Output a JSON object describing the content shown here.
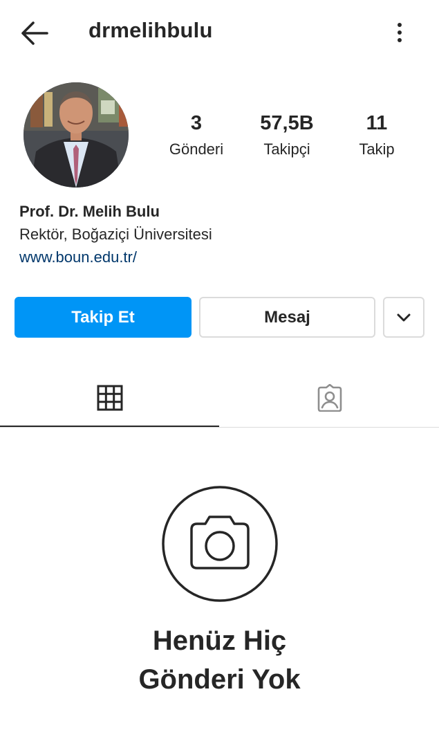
{
  "header": {
    "username": "drmelihbulu",
    "back_icon": "arrow-left-icon",
    "more_icon": "vertical-dots-icon"
  },
  "profile": {
    "avatar": "profile-photo",
    "stats": {
      "posts_count": "3",
      "posts_label": "Gönderi",
      "followers_count": "57,5B",
      "followers_label": "Takipçi",
      "following_count": "11",
      "following_label": "Takip"
    },
    "bio": {
      "name": "Prof. Dr. Melih Bulu",
      "description": "Rektör, Boğaziçi Üniversitesi",
      "link": "www.boun.edu.tr/"
    }
  },
  "actions": {
    "follow_label": "Takip Et",
    "message_label": "Mesaj",
    "more_icon": "chevron-down-icon"
  },
  "tabs": {
    "grid_icon": "grid-icon",
    "tagged_icon": "tagged-person-icon",
    "active": "grid"
  },
  "empty_state": {
    "icon": "camera-icon",
    "title": "Henüz Hiç\nGönderi Yok"
  },
  "colors": {
    "accent": "#0095f6",
    "text": "#262626",
    "link": "#00376b",
    "border": "#dbdbdb"
  }
}
